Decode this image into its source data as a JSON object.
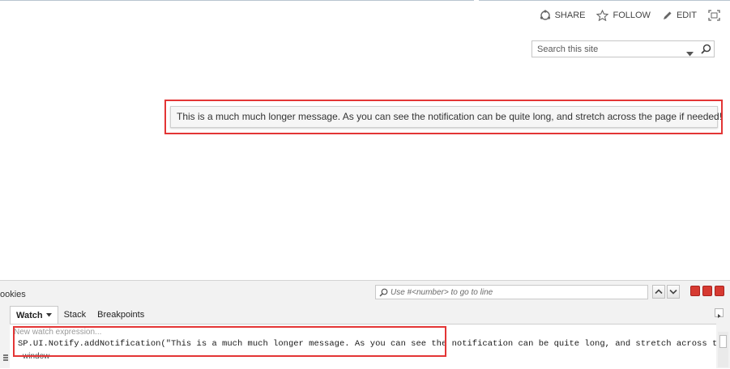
{
  "header": {
    "share_label": "SHARE",
    "follow_label": "FOLLOW",
    "edit_label": "EDIT"
  },
  "search": {
    "placeholder": "Search this site"
  },
  "notification": {
    "message": "This is a much much longer message. As you can see the notification can be quite long, and stretch across the page if needed!"
  },
  "devtools": {
    "menu_fragment": "ookies",
    "goto_placeholder": "Use #<number> to go to line",
    "tabs": [
      {
        "label": "Watch"
      },
      {
        "label": "Stack"
      },
      {
        "label": "Breakpoints"
      }
    ],
    "watch": {
      "new_expression": "New watch expression...",
      "expression": "SP.UI.Notify.addNotification(\"This is a much much longer message. As you can see the notification can be quite long, and stretch across th",
      "window_row": "window"
    }
  },
  "colors": {
    "highlight": "#e33535",
    "window_close": "#d63a31"
  }
}
